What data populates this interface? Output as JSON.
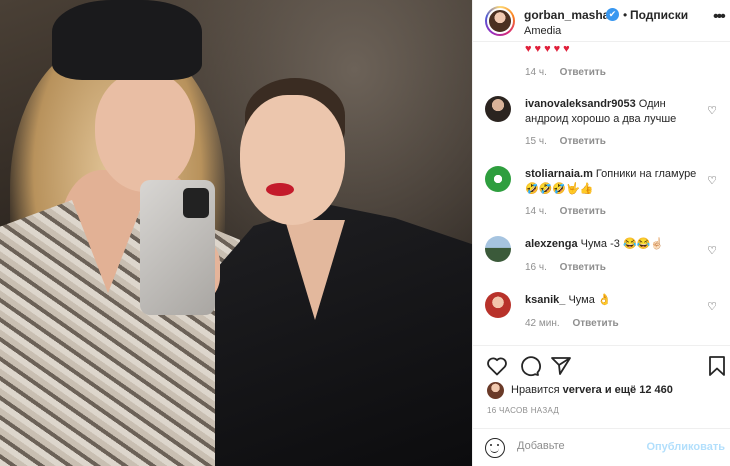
{
  "post": {
    "username": "gorban_masha",
    "verified_mark": "✔",
    "separator": "•",
    "follow_label": "Подписки",
    "location": "Amedia",
    "more_label": "•••"
  },
  "comments": {
    "first_hearts": "♥♥♥♥♥",
    "first_time": "14 ч.",
    "reply_label": "Ответить",
    "items": [
      {
        "user": "ivanovaleksandr9053",
        "text": "Один андроид хорошо а два лучше",
        "time": "15 ч.",
        "avatar": "avatar-dark-hair"
      },
      {
        "user": "stoliarnaia.m",
        "text": "Гопники на гламуре 🤣🤣🤣🤟👍",
        "time": "14 ч.",
        "avatar": "avatar-green-logo"
      },
      {
        "user": "alexzenga",
        "text": "Чума -3 😂😂☝🏻",
        "time": "16 ч.",
        "avatar": "avatar-landscape"
      },
      {
        "user": "ksanik_",
        "text": "Чума 👌",
        "time": "42 мин.",
        "avatar": "avatar-red-hair"
      }
    ]
  },
  "likes": {
    "prefix": "Нравится",
    "user": "ververa",
    "suffix": "и ещё 12 460"
  },
  "timeago": "16 ЧАСОВ НАЗАД",
  "add_comment": {
    "placeholder": "Добавьте",
    "publish_label": "Опубликовать"
  },
  "colors": {
    "accent_blue": "#3897f0",
    "publish_disabled": "#b2dffc",
    "heart_red": "#e0203a",
    "text_main": "#262626",
    "text_muted": "#8e8e8e"
  }
}
